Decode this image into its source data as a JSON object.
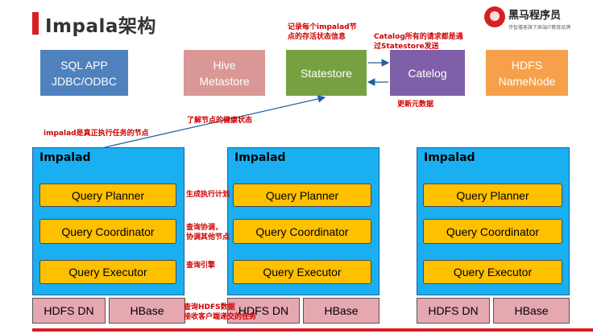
{
  "header": {
    "title": "Impala架构",
    "logo_name": "黑马程序员",
    "logo_sub": "传智播客旗下高端IT教育品牌",
    "accent_color": "#d62020"
  },
  "top_boxes": {
    "client": "SQL APP\nJDBC/ODBC",
    "hive": "Hive\nMetastore",
    "statestore": "Statestore",
    "catalog": "Catelog",
    "hdfs": "HDFS\nNameNode"
  },
  "nodes": [
    {
      "title": "Impalad",
      "planner": "Query Planner",
      "coordinator": "Query Coordinator",
      "executor": "Query Executor",
      "dn": "HDFS DN",
      "hbase": "HBase"
    },
    {
      "title": "Impalad",
      "planner": "Query Planner",
      "coordinator": "Query Coordinator",
      "executor": "Query Executor",
      "dn": "HDFS DN",
      "hbase": "HBase"
    },
    {
      "title": "Impalad",
      "planner": "Query Planner",
      "coordinator": "Query Coordinator",
      "executor": "Query Executor",
      "dn": "HDFS DN",
      "hbase": "HBase"
    }
  ],
  "notes": {
    "statestore_note": "记录每个impalad节\n点的存活状态信息",
    "catalog_note": "Catalog所有的请求都是通\n过Statestore发送",
    "catalog_update": "更新元数据",
    "health": "了解节点的健康状态",
    "impalad_note": "impalad是真正执行任务的节点",
    "planner_note": "生成执行计划",
    "coordinator_note": "查询协调，\n协调其他节点",
    "executor_note": "查询引擎",
    "data_note": "查询HDFS数据\n接收客户端递交的任务"
  },
  "colors": {
    "client": "#4f81bd",
    "hive": "#d99795",
    "statestore": "#77a141",
    "catalog": "#7f5fa8",
    "hdfs": "#f7a04b",
    "impalad": "#1aaff0",
    "query": "#ffc000",
    "storage": "#e6a8b0"
  }
}
